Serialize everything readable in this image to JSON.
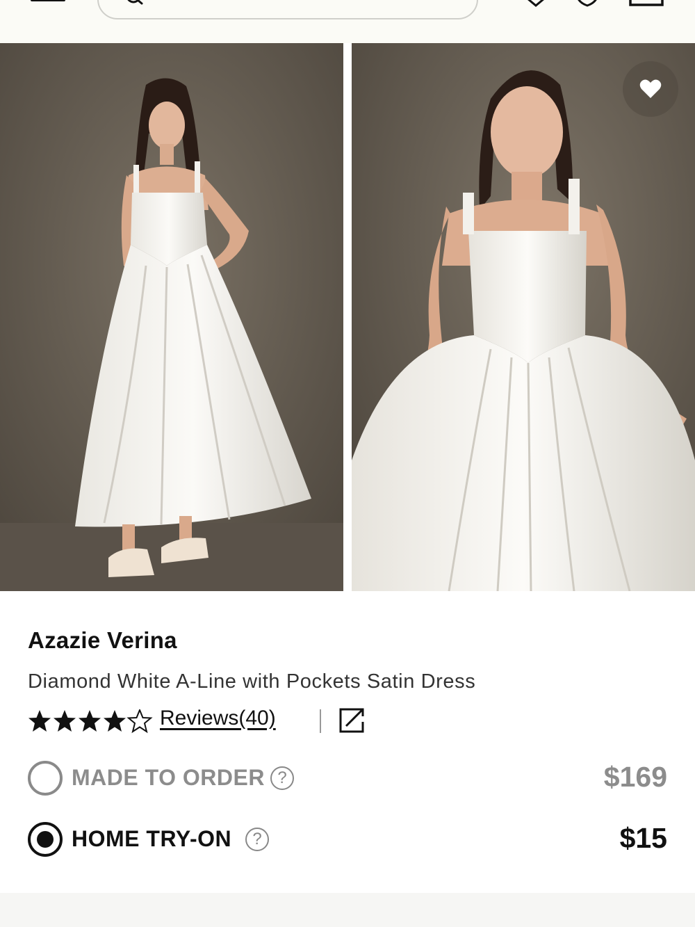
{
  "header": {
    "menu_icon": "hamburger-icon",
    "search_icon": "search-icon",
    "icons": [
      "location-icon",
      "heart-icon",
      "bag-icon"
    ]
  },
  "gallery": {
    "images": [
      {
        "alt_icon": "product-photo-full-length"
      },
      {
        "alt_icon": "product-photo-closeup"
      }
    ],
    "favorite_icon": "heart-filled-icon"
  },
  "product": {
    "brand": "Azazie Verina",
    "subtitle": "Diamond White A-Line with Pockets Satin Dress",
    "rating": 4.5,
    "rating_max": 5,
    "reviews_label": "Reviews(40)",
    "share_icon": "external-link-icon"
  },
  "options": [
    {
      "label": "MADE TO ORDER",
      "price": "$169",
      "selected": false,
      "help": "?"
    },
    {
      "label": "HOME TRY-ON",
      "price": "$15",
      "selected": true,
      "help": "?"
    }
  ],
  "colors": {
    "header_bg": "#fbfbf6",
    "text_primary": "#111111",
    "text_muted": "#8c8c8c"
  }
}
